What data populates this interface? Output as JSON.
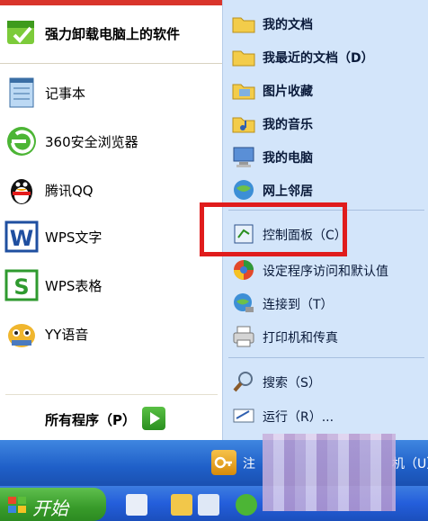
{
  "left_pane": {
    "pinned": {
      "label": "强力卸载电脑上的软件",
      "icon": "uninstall-icon"
    },
    "items": [
      {
        "label": "记事本",
        "icon": "notepad-icon"
      },
      {
        "label": "360安全浏览器",
        "icon": "browser-360-icon"
      },
      {
        "label": "腾讯QQ",
        "icon": "qq-penguin-icon"
      },
      {
        "label": "WPS文字",
        "icon": "wps-writer-icon"
      },
      {
        "label": "WPS表格",
        "icon": "wps-spreadsheet-icon"
      },
      {
        "label": "YY语音",
        "icon": "yy-voice-icon"
      }
    ],
    "all_programs": "所有程序（P）"
  },
  "right_pane": {
    "items": [
      {
        "label": "我的文档",
        "icon": "folder-icon"
      },
      {
        "label": "我最近的文档（D）",
        "icon": "folder-recent-icon"
      },
      {
        "label": "图片收藏",
        "icon": "pictures-folder-icon"
      },
      {
        "label": "我的音乐",
        "icon": "music-folder-icon"
      },
      {
        "label": "我的电脑",
        "icon": "computer-icon"
      },
      {
        "label": "网上邻居",
        "icon": "network-icon"
      },
      {
        "label": "控制面板（C）",
        "icon": "control-panel-icon"
      },
      {
        "label": "设定程序访问和默认值",
        "icon": "program-defaults-icon"
      },
      {
        "label": "连接到（T）",
        "icon": "connect-icon"
      },
      {
        "label": "打印机和传真",
        "icon": "printer-icon"
      },
      {
        "label": "搜索（S）",
        "icon": "search-icon"
      },
      {
        "label": "运行（R）...",
        "icon": "run-icon"
      }
    ]
  },
  "footer": {
    "logoff": "注",
    "shutdown": "机（U）"
  },
  "taskbar": {
    "start_label": "开始"
  },
  "colors": {
    "highlight": "#e01c1c",
    "right_pane": "#d3e5fa",
    "taskbar": "#245edb",
    "start": "#389b2a"
  }
}
